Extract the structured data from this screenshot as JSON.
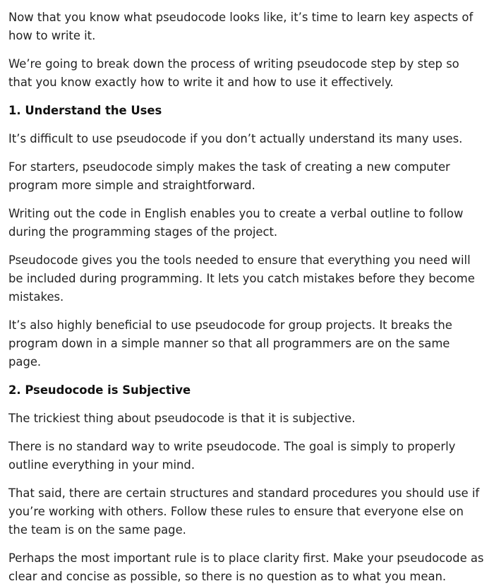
{
  "article": {
    "paragraphs_intro": [
      "Now that you know what pseudocode looks like, it’s time to learn key aspects of how to write it.",
      "We’re going to break down the process of writing pseudocode step by step so that you know exactly how to write it and how to use it effectively."
    ],
    "section1": {
      "heading": "1. Understand the Uses",
      "paragraphs": [
        "It’s difficult to use pseudocode if you don’t actually understand its many uses.",
        "For starters, pseudocode simply makes the task of creating a new computer program more simple and straightforward.",
        "Writing out the code in English enables you to create a verbal outline to follow during the programming stages of the project.",
        "Pseudocode gives you the tools needed to ensure that everything you need will be included during programming. It lets you catch mistakes before they become mistakes.",
        "It’s also highly beneficial to use pseudocode for group projects. It breaks the program down in a simple manner so that all programmers are on the same page."
      ]
    },
    "section2": {
      "heading": "2. Pseudocode is Subjective",
      "paragraphs": [
        "The trickiest thing about pseudocode is that it is subjective.",
        "There is no standard way to write pseudocode. The goal is simply to properly outline everything in your mind.",
        "That said, there are certain structures and standard procedures you should use if you’re working with others. Follow these rules to ensure that everyone else on the team is on the same page.",
        "Perhaps the most important rule is to place clarity first. Make your pseudocode as clear and concise as possible, so there is no question as to what you mean."
      ]
    }
  }
}
